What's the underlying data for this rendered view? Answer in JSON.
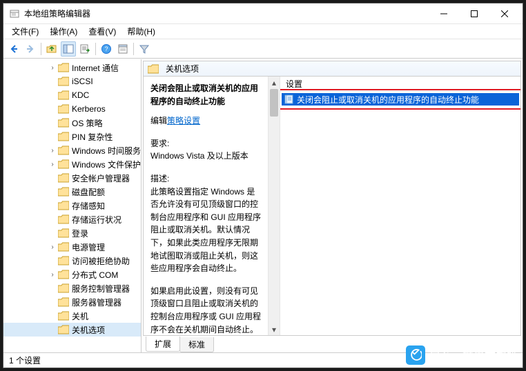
{
  "window": {
    "title": "本地组策略编辑器"
  },
  "menu": {
    "file": "文件(F)",
    "action": "操作(A)",
    "view": "查看(V)",
    "help": "帮助(H)"
  },
  "tree": {
    "items": [
      {
        "level": 4,
        "exp": ">",
        "label": "Internet 通信"
      },
      {
        "level": 4,
        "exp": "",
        "label": "iSCSI"
      },
      {
        "level": 4,
        "exp": "",
        "label": "KDC"
      },
      {
        "level": 4,
        "exp": "",
        "label": "Kerberos"
      },
      {
        "level": 4,
        "exp": "",
        "label": "OS 策略"
      },
      {
        "level": 4,
        "exp": "",
        "label": "PIN 复杂性"
      },
      {
        "level": 4,
        "exp": ">",
        "label": "Windows 时间服务"
      },
      {
        "level": 4,
        "exp": ">",
        "label": "Windows 文件保护"
      },
      {
        "level": 4,
        "exp": "",
        "label": "安全帐户管理器"
      },
      {
        "level": 4,
        "exp": "",
        "label": "磁盘配额"
      },
      {
        "level": 4,
        "exp": "",
        "label": "存储感知"
      },
      {
        "level": 4,
        "exp": "",
        "label": "存储运行状况"
      },
      {
        "level": 4,
        "exp": "",
        "label": "登录"
      },
      {
        "level": 4,
        "exp": ">",
        "label": "电源管理"
      },
      {
        "level": 4,
        "exp": "",
        "label": "访问被拒绝协助"
      },
      {
        "level": 4,
        "exp": ">",
        "label": "分布式 COM"
      },
      {
        "level": 4,
        "exp": "",
        "label": "服务控制管理器"
      },
      {
        "level": 4,
        "exp": "",
        "label": "服务器管理器"
      },
      {
        "level": 4,
        "exp": "",
        "label": "关机"
      },
      {
        "level": 4,
        "exp": "",
        "label": "关机选项",
        "selected": true
      }
    ]
  },
  "header": {
    "title": "关机选项"
  },
  "detail": {
    "title": "关闭会阻止或取消关机的应用程序的自动终止功能",
    "edit_prefix": "编辑",
    "edit_link": "策略设置",
    "req_label": "要求:",
    "req_value": "Windows Vista 及以上版本",
    "desc_label": "描述:",
    "desc_p1": "此策略设置指定 Windows 是否允许没有可见顶级窗口的控制台应用程序和 GUI 应用程序阻止或取消关机。默认情况下，如果此类应用程序无限期地试图取消或阻止关机，则这些应用程序会自动终止。",
    "desc_p2": "如果启用此设置，则没有可见顶级窗口且阻止或取消关机的控制台应用程序或 GUI 应用程序不会在关机期间自动终止。"
  },
  "list": {
    "column": "设置",
    "items": [
      {
        "label": "关闭会阻止或取消关机的应用程序的自动终止功能",
        "selected": true
      }
    ]
  },
  "tabs": {
    "extended": "扩展",
    "standard": "标准"
  },
  "status": {
    "text": "1 个设置"
  },
  "watermark": {
    "line1": "白云一键重装系统",
    "line2": "www.baiyunxitong.com"
  }
}
